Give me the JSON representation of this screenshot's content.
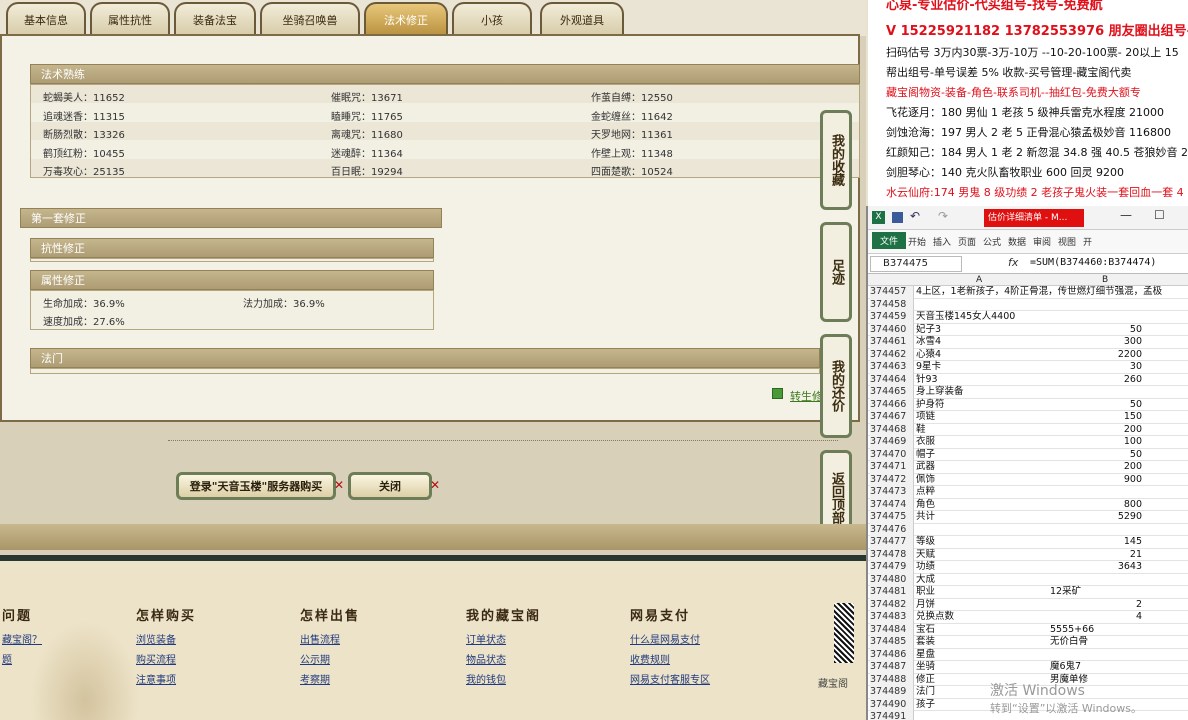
{
  "tabs": [
    {
      "label": "基本信息"
    },
    {
      "label": "属性抗性"
    },
    {
      "label": "装备法宝"
    },
    {
      "label": "坐骑召唤兽"
    },
    {
      "label": "法术修正"
    },
    {
      "label": "小孩"
    },
    {
      "label": "外观道具"
    }
  ],
  "skills": {
    "title": "法术熟练",
    "rows": [
      [
        "蛇蝎美人：11652",
        "催眠咒：13671",
        "作茧自缚：12550"
      ],
      [
        "追魂迷香：11315",
        "瞌睡咒：11765",
        "金蛇缠丝：11642"
      ],
      [
        "断肠烈散：13326",
        "离魂咒：11680",
        "天罗地网：11361"
      ],
      [
        "鹤顶红粉：10455",
        "迷魂醉：11364",
        "作壁上观：11348"
      ],
      [
        "万毒攻心：25135",
        "百日眠：19294",
        "四面楚歌：10524"
      ]
    ]
  },
  "mod": {
    "title": "第一套修正",
    "resist_title": "抗性修正",
    "attr_title": "属性修正",
    "attr_rows": [
      [
        "生命加成：36.9%",
        "法力加成：36.9%"
      ],
      [
        "速度加成：27.6%",
        ""
      ]
    ],
    "school_title": "法门"
  },
  "side_buttons": [
    "我的收藏",
    "足迹",
    "我的还价",
    "返回顶部"
  ],
  "link_partial": "转生修",
  "buttons": {
    "login": "登录\"天音玉楼\"服务器购买",
    "close": "关闭"
  },
  "footer": {
    "cols": [
      {
        "title": "问题",
        "links": [
          "藏宝阁？",
          "题"
        ]
      },
      {
        "title": "怎样购买",
        "links": [
          "浏览装备",
          "购买流程",
          "注意事项"
        ]
      },
      {
        "title": "怎样出售",
        "links": [
          "出售流程",
          "公示期",
          "考察期"
        ]
      },
      {
        "title": "我的藏宝阁",
        "links": [
          "订单状态",
          "物品状态",
          "我的钱包"
        ]
      },
      {
        "title": "网易支付",
        "links": [
          "什么是网易支付",
          "收费规则",
          "网易支付客服专区"
        ]
      }
    ],
    "qr_label": "藏宝阁"
  },
  "ad": {
    "lines": [
      {
        "text": "心泉-专业估价-代买组号-找号-免费航",
        "color": "#e0101a"
      },
      {
        "text": "V 15225921182  13782553976 朋友圈出组号-",
        "color": "#e0101a"
      },
      {
        "text": "扫码估号 3万内30票-3万-10万 --10-20-100票- 20以上 15",
        "color": "#111"
      },
      {
        "text": "帮出组号-单号误差 5% 收款-买号管理-藏宝阁代卖",
        "color": "#111"
      },
      {
        "text": "藏宝阁物资-装备-角色-联系司机--抽红包-免费大额专",
        "color": "#e0101a"
      },
      {
        "text": "飞花逐月：180 男仙 1 老孩 5 级神兵雷克水程度 21000",
        "color": "#111"
      },
      {
        "text": "剑蚀沧海：197 男人 2 老 5 正骨混心猿孟极妙音 116800",
        "color": "#111"
      },
      {
        "text": "红颜知己：184 男人 1 老 2 新忽混 34.8 强 40.5 苍狼妙音 229",
        "color": "#111"
      },
      {
        "text": "剑胆琴心：140 克火队畜牧职业 600 回灵 9200",
        "color": "#111"
      },
      {
        "text": "水云仙府:174 男鬼 8 级功绩 2 老孩子鬼火装一套回血一套 4",
        "color": "#e0101a"
      }
    ]
  },
  "excel": {
    "title": "估价详细清单 - M...",
    "ribbon": [
      "文件",
      "开始",
      "插入",
      "页面",
      "公式",
      "数据",
      "审阅",
      "视图",
      "开"
    ],
    "cell_ref": "B374475",
    "formula": "=SUM(B374460:B374474)",
    "col_a": "A",
    "col_b": "B",
    "rows": [
      {
        "n": "374457",
        "a": "4上区，1老新孩子，4阶正骨混，传世燃灯细节强混，孟极",
        "b": ""
      },
      {
        "n": "374458",
        "a": "",
        "b": ""
      },
      {
        "n": "374459",
        "a": "天音玉楼145女人4400",
        "b": ""
      },
      {
        "n": "374460",
        "a": "妃子3",
        "b": "50"
      },
      {
        "n": "374461",
        "a": "冰雪4",
        "b": "300"
      },
      {
        "n": "374462",
        "a": "心猿4",
        "b": "2200"
      },
      {
        "n": "374463",
        "a": "9星卡",
        "b": "30"
      },
      {
        "n": "374464",
        "a": "针93",
        "b": "260"
      },
      {
        "n": "374465",
        "a": "身上穿装备",
        "b": ""
      },
      {
        "n": "374466",
        "a": "护身符",
        "b": "50"
      },
      {
        "n": "374467",
        "a": "项链",
        "b": "150"
      },
      {
        "n": "374468",
        "a": "鞋",
        "b": "200"
      },
      {
        "n": "374469",
        "a": "衣服",
        "b": "100"
      },
      {
        "n": "374470",
        "a": "帽子",
        "b": "50"
      },
      {
        "n": "374471",
        "a": "武器",
        "b": "200"
      },
      {
        "n": "374472",
        "a": "佩饰",
        "b": "900"
      },
      {
        "n": "374473",
        "a": "点粹",
        "b": ""
      },
      {
        "n": "374474",
        "a": "角色",
        "b": "800"
      },
      {
        "n": "374475",
        "a": "共计",
        "b": "5290"
      },
      {
        "n": "374476",
        "a": "",
        "b": ""
      },
      {
        "n": "374477",
        "a": "等级",
        "b": "145"
      },
      {
        "n": "374478",
        "a": "天赋",
        "b": "21"
      },
      {
        "n": "374479",
        "a": "功绩",
        "b": "3643"
      },
      {
        "n": "374480",
        "a": "大成",
        "b": ""
      },
      {
        "n": "374481",
        "a": "职业",
        "b": "12采矿"
      },
      {
        "n": "374482",
        "a": "月饼",
        "b": "2"
      },
      {
        "n": "374483",
        "a": "兑换点数",
        "b": "4"
      },
      {
        "n": "374484",
        "a": "宝石",
        "b": "5555+66"
      },
      {
        "n": "374485",
        "a": "套装",
        "b": "无价白骨"
      },
      {
        "n": "374486",
        "a": "星盘",
        "b": ""
      },
      {
        "n": "374487",
        "a": "坐骑",
        "b": "魔6鬼7"
      },
      {
        "n": "374488",
        "a": "修正",
        "b": "男魔单修"
      },
      {
        "n": "374489",
        "a": "法门",
        "b": ""
      },
      {
        "n": "374490",
        "a": "孩子",
        "b": ""
      },
      {
        "n": "374491",
        "a": "",
        "b": ""
      }
    ]
  },
  "watermark": {
    "line1": "激活 Windows",
    "line2": "转到“设置”以激活 Windows。"
  }
}
